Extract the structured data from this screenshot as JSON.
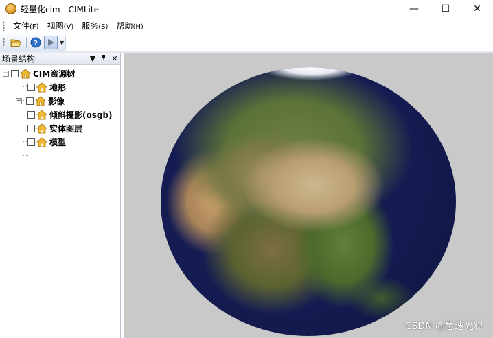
{
  "window": {
    "title": "轻量化cim - CIMLite",
    "controls": {
      "minimize": "—",
      "maximize": "☐",
      "close": "✕"
    }
  },
  "menu": [
    {
      "label": "文件",
      "key": "(F)"
    },
    {
      "label": "视图",
      "key": "(V)"
    },
    {
      "label": "服务",
      "key": "(S)"
    },
    {
      "label": "帮助",
      "key": "(H)"
    }
  ],
  "toolbar": {
    "buttons": [
      {
        "icon": "open-folder-icon"
      },
      {
        "icon": "help-icon"
      },
      {
        "icon": "play-icon"
      }
    ]
  },
  "panel": {
    "title": "场景结构",
    "controls": {
      "dropdown": "▼",
      "pin": "ᵖ",
      "close": "✕"
    }
  },
  "tree": {
    "root": {
      "label": "CIM资源树",
      "expander": "−"
    },
    "children": [
      {
        "label": "地形",
        "expander": ""
      },
      {
        "label": "影像",
        "expander": "+"
      },
      {
        "label": "倾斜摄影(osgb)",
        "expander": ""
      },
      {
        "label": "实体图层",
        "expander": ""
      },
      {
        "label": "模型",
        "expander": ""
      }
    ]
  },
  "viewport": {
    "watermark": "CSDN @急速光粒"
  },
  "colors": {
    "viewport_bg": "#c9c9c9",
    "ocean": "#151c52",
    "icon_yellow": "#f2b935"
  }
}
